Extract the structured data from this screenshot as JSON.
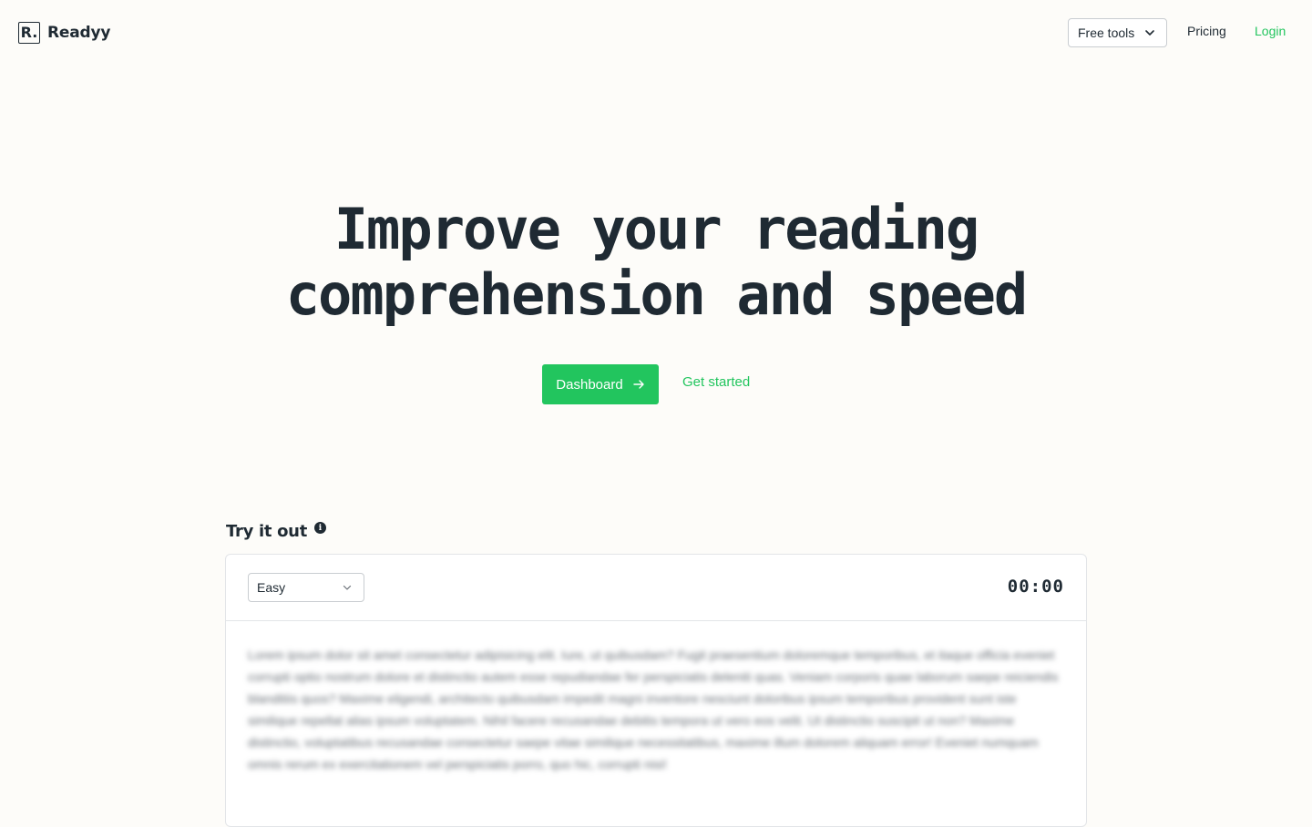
{
  "header": {
    "logo_mark": "R.",
    "brand": "Readyy",
    "nav": {
      "free_tools": "Free tools",
      "pricing": "Pricing",
      "login": "Login"
    }
  },
  "hero": {
    "title_line1": "Improve your reading",
    "title_line2": "comprehension and speed",
    "dashboard_button": "Dashboard",
    "get_started": "Get started"
  },
  "try_it": {
    "title": "Try it out",
    "info_glyph": "i",
    "difficulty": "Easy",
    "timer": "00:00",
    "passage": "Lorem ipsum dolor sit amet consectetur adipisicing elit. Iure, ut quibusdam? Fugit praesentium doloremque temporibus, et itaque officia eveniet corrupti optio nostrum dolore et distinctio autem esse repudiandae fer perspiciatis deleniti quas. Veniam corporis quae laborum saepe reiciendis blanditiis quos? Maxime eligendi, architecto quibusdam impedit magni inventore nesciunt doloribus ipsum temporibus provident sunt iste similique repellat alias ipsum voluptatem. Nihil facere recusandae debitis tempora ut vero eos velit. Ut distinctio suscipit ut non? Maxime distinctio, voluptatibus recusandae consectetur saepe vitae similique necessitatibus, maxime illum dolorem aliquam error! Eveniet numquam omnis rerum ex exercitationem vel perspiciatis porro, quo hic, corrupti nisi!"
  },
  "colors": {
    "accent": "#22c55e",
    "text": "#1f2a33",
    "background": "#fdfcf9"
  },
  "icons": {
    "free_tools_caret": "chevron-down-icon",
    "dashboard_arrow": "arrow-right-icon",
    "info": "info-icon",
    "difficulty_caret": "chevron-down-icon"
  }
}
